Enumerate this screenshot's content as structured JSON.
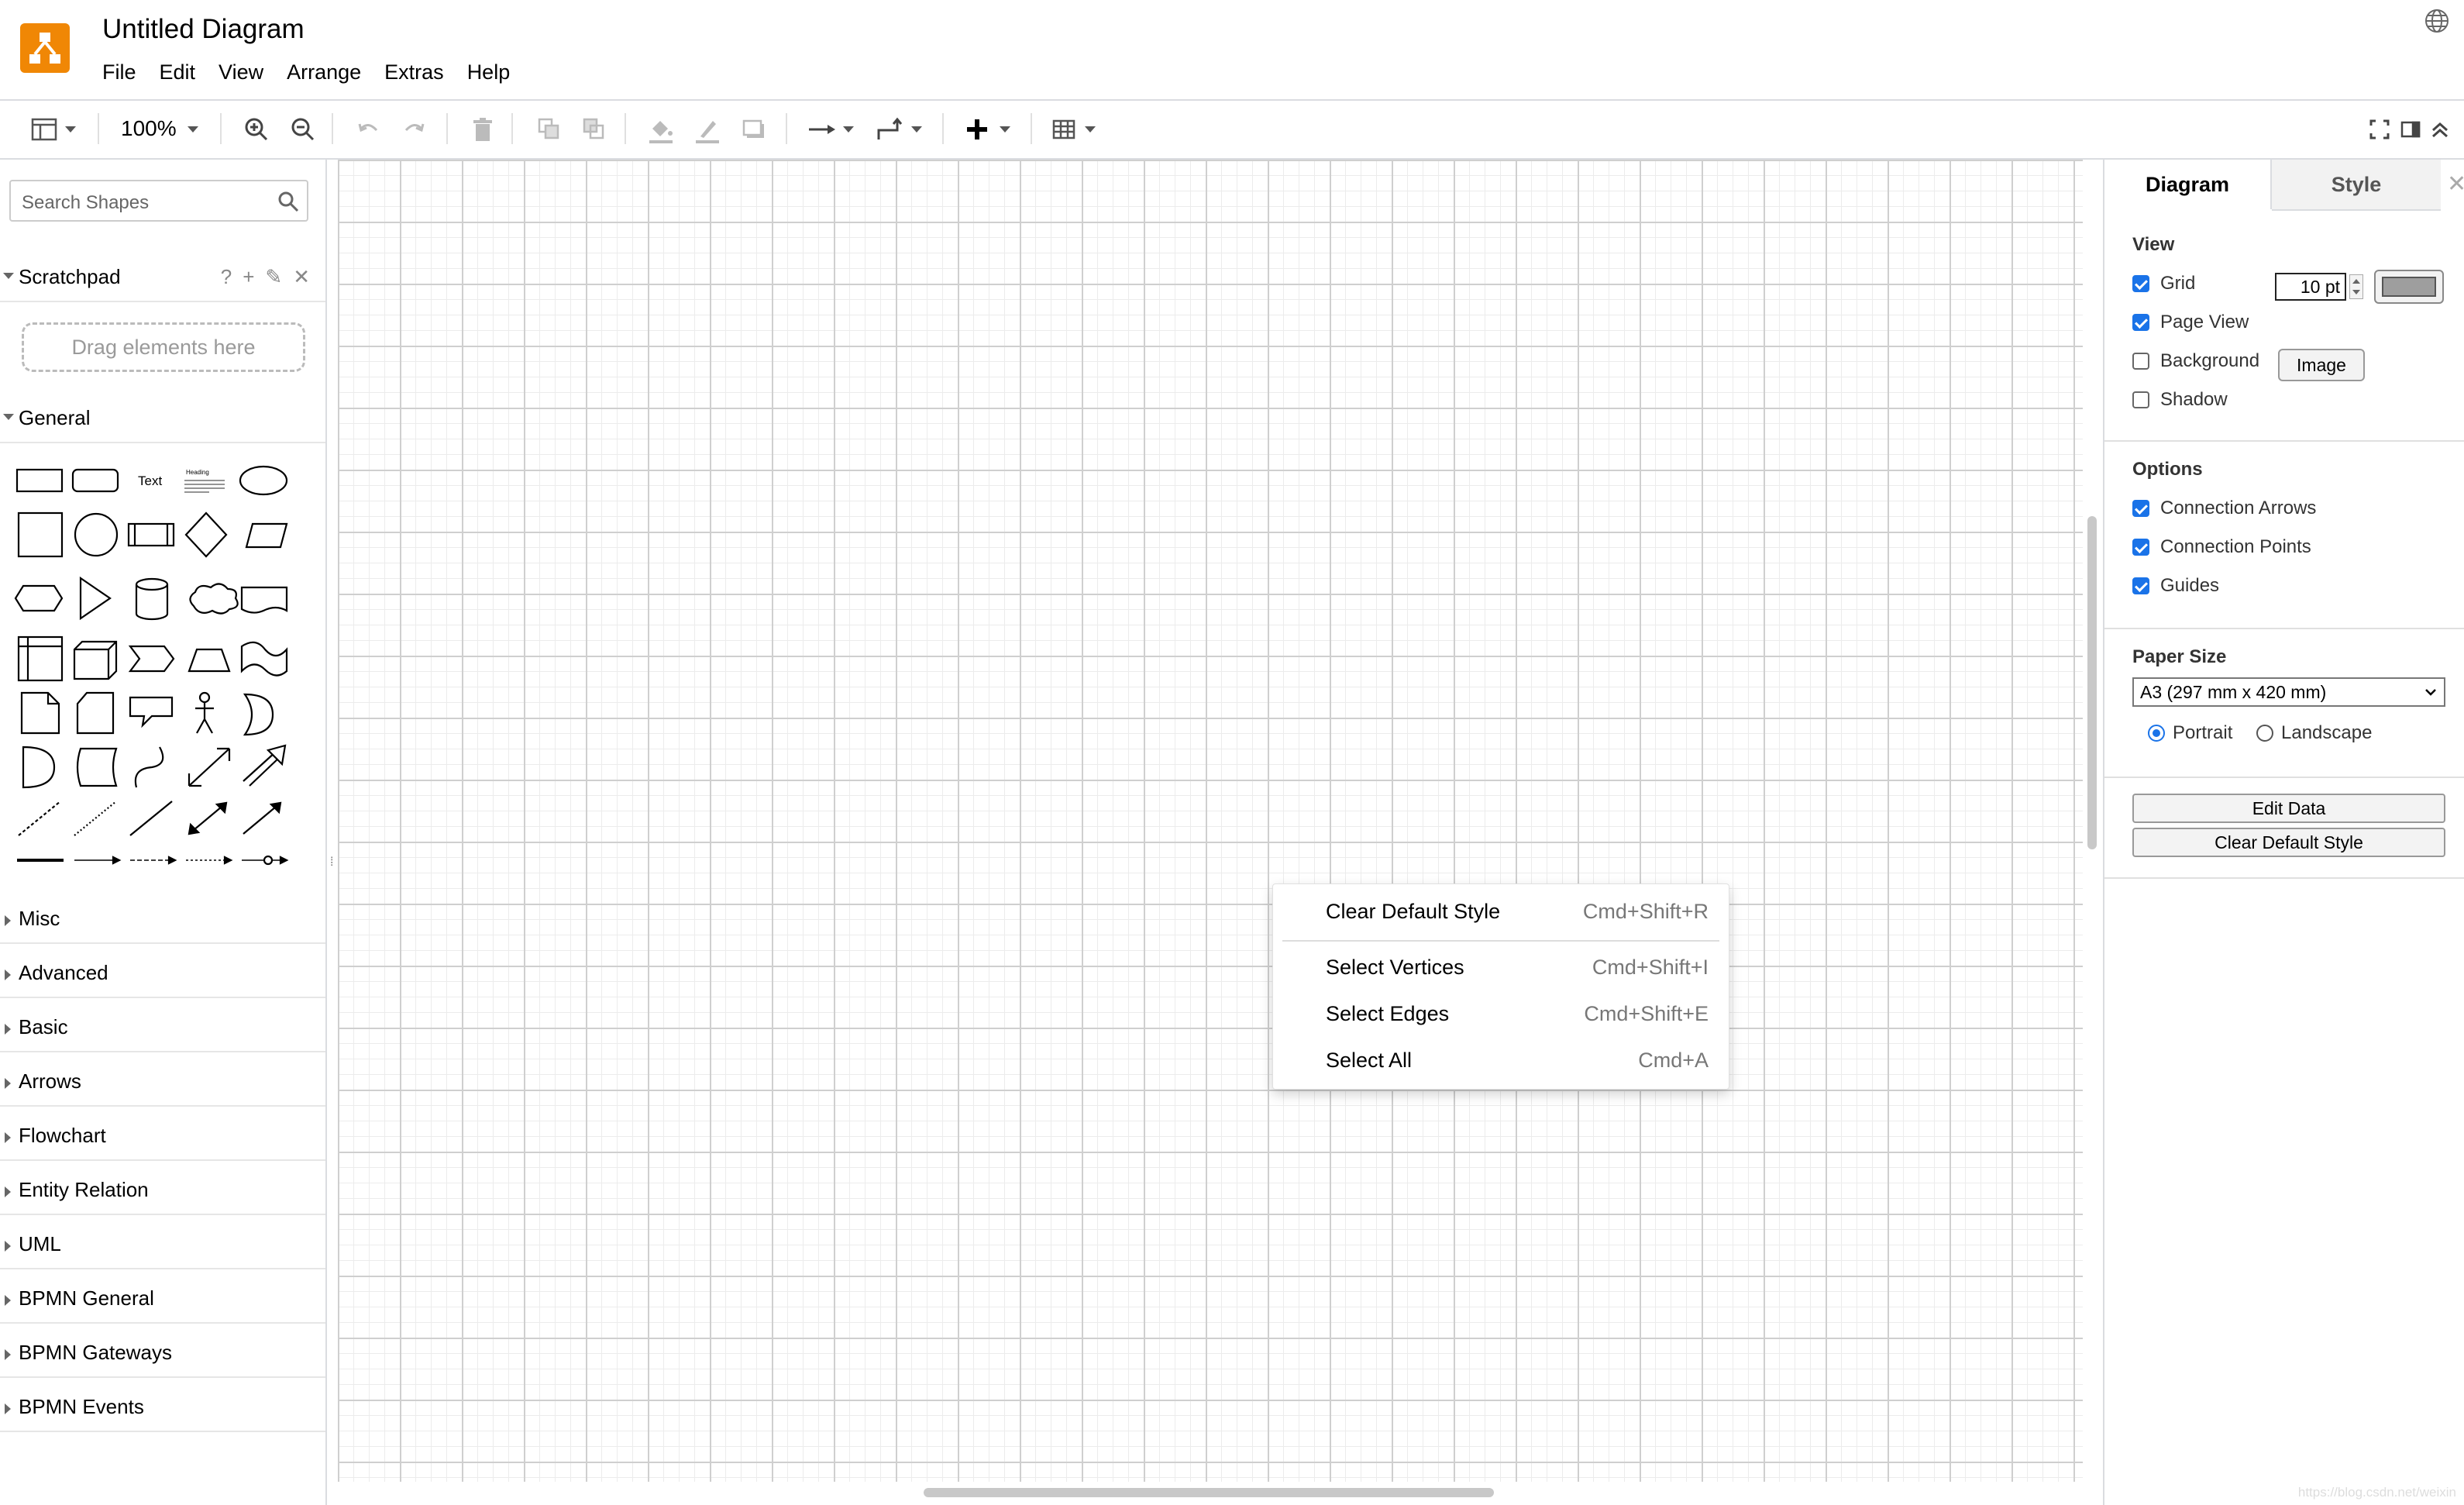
{
  "app": {
    "title": "Untitled Diagram",
    "menu": [
      "File",
      "Edit",
      "View",
      "Arrange",
      "Extras",
      "Help"
    ],
    "accent": "#f08705"
  },
  "toolbar": {
    "zoom": "100%",
    "icons": [
      "format-panel-icon",
      "zoom-in-icon",
      "zoom-out-icon",
      "undo-icon",
      "redo-icon",
      "delete-icon",
      "to-front-icon",
      "to-back-icon",
      "fill-color-icon",
      "line-color-icon",
      "shadow-icon",
      "connection-icon",
      "waypoints-icon",
      "insert-icon",
      "table-icon",
      "fullscreen-icon",
      "format-toggle-icon",
      "collapse-icon"
    ]
  },
  "sidebar": {
    "search_placeholder": "Search Shapes",
    "scratchpad": {
      "label": "Scratchpad",
      "drop_hint": "Drag elements here"
    },
    "general": {
      "label": "General",
      "text_shape": "Text",
      "heading_shape": "Heading"
    },
    "sections": [
      "Misc",
      "Advanced",
      "Basic",
      "Arrows",
      "Flowchart",
      "Entity Relation",
      "UML",
      "BPMN General",
      "BPMN Gateways",
      "BPMN Events"
    ]
  },
  "context_menu": {
    "items": [
      {
        "label": "Clear Default Style",
        "shortcut": "Cmd+Shift+R"
      },
      {
        "label": "Select Vertices",
        "shortcut": "Cmd+Shift+I"
      },
      {
        "label": "Select Edges",
        "shortcut": "Cmd+Shift+E"
      },
      {
        "label": "Select All",
        "shortcut": "Cmd+A"
      }
    ]
  },
  "format_panel": {
    "tabs": [
      "Diagram",
      "Style"
    ],
    "view": {
      "heading": "View",
      "grid": "Grid",
      "grid_size": "10 pt",
      "page_view": "Page View",
      "background": "Background",
      "image_button": "Image",
      "shadow": "Shadow",
      "grid_color": "#9e9e9e"
    },
    "options": {
      "heading": "Options",
      "connection_arrows": "Connection Arrows",
      "connection_points": "Connection Points",
      "guides": "Guides"
    },
    "paper": {
      "heading": "Paper Size",
      "size": "A3 (297 mm x 420 mm)",
      "portrait": "Portrait",
      "landscape": "Landscape"
    },
    "buttons": {
      "edit_data": "Edit Data",
      "clear_default_style": "Clear Default Style"
    }
  },
  "watermark": "https://blog.csdn.net/weixin"
}
